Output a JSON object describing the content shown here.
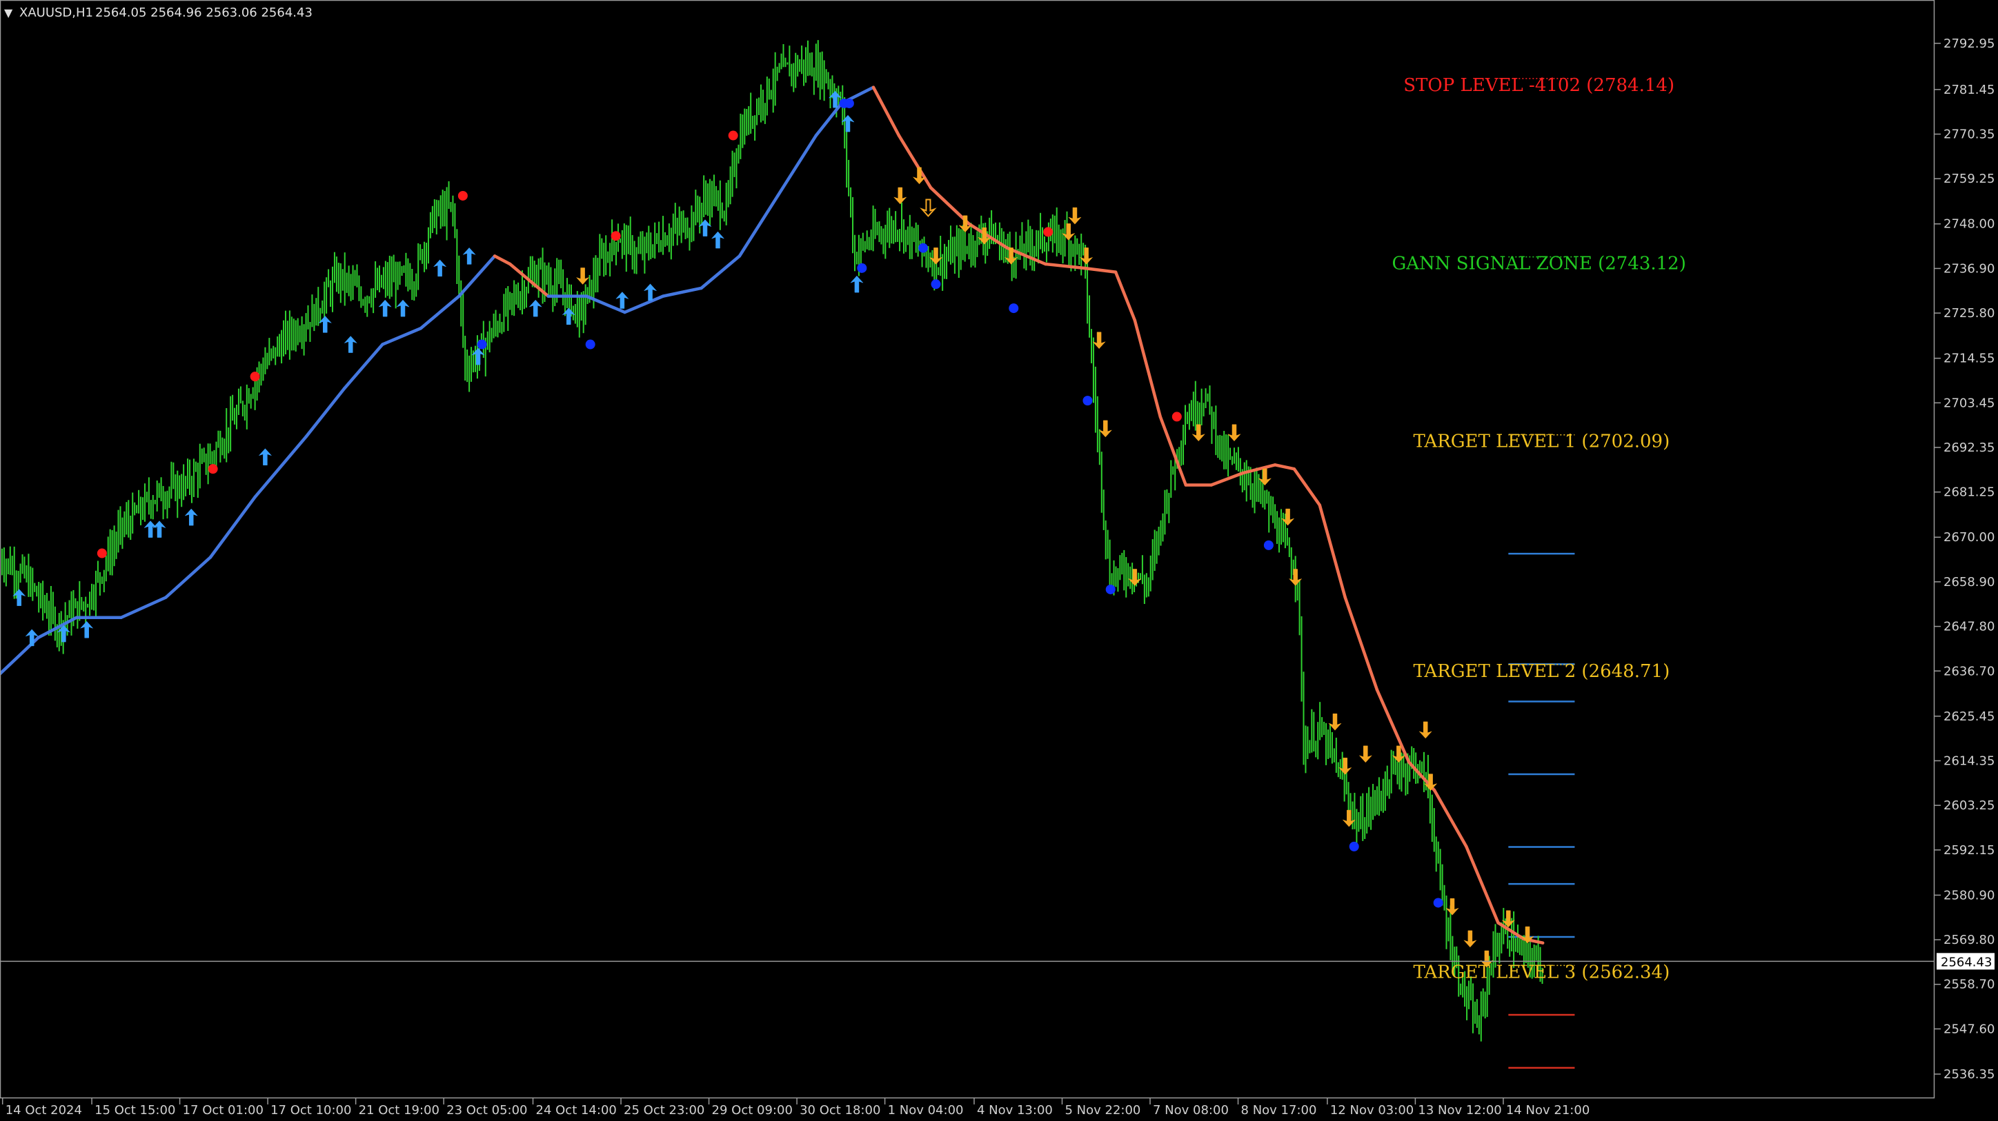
{
  "header": {
    "symbol": "XAUUSD,H1",
    "ohlc": "2564.05 2564.96 2563.06 2564.43"
  },
  "current_price": "2564.43",
  "colors": {
    "background": "#000000",
    "axis": "#9a9a9a",
    "candle": "#2fd12f",
    "ma_up": "#4477e0",
    "ma_down": "#f07050",
    "arrow_up": "#3aa0ff",
    "arrow_down": "#f5a623",
    "dot_red": "#ff1a1a",
    "dot_blue": "#1030ff",
    "stop_level": "#ff2020",
    "gann_zone": "#22cc22",
    "target": "#f0c020",
    "hline_blue": "#2f7fd8",
    "hline_red": "#d83020"
  },
  "chart_data": {
    "type": "line",
    "series": [
      {
        "name": "XAUUSD,H1",
        "x": [
          "14 Oct 2024",
          "15 Oct 15:00",
          "17 Oct 01:00",
          "17 Oct 10:00",
          "21 Oct 19:00",
          "23 Oct 05:00",
          "24 Oct 14:00",
          "25 Oct 23:00",
          "29 Oct 09:00",
          "30 Oct 18:00",
          "1 Nov 04:00",
          "4 Nov 13:00",
          "5 Nov 22:00",
          "7 Nov 08:00",
          "8 Nov 17:00",
          "12 Nov 03:00",
          "13 Nov 12:00",
          "14 Nov 21:00"
        ],
        "values": [
          2660,
          2650,
          2672,
          2690,
          2720,
          2745,
          2735,
          2740,
          2760,
          2788,
          2750,
          2742,
          2738,
          2700,
          2668,
          2625,
          2572,
          2564
        ]
      }
    ],
    "price_path": [
      [
        0,
        2665
      ],
      [
        20,
        2660
      ],
      [
        45,
        2648
      ],
      [
        70,
        2655
      ],
      [
        95,
        2672
      ],
      [
        120,
        2680
      ],
      [
        145,
        2683
      ],
      [
        165,
        2690
      ],
      [
        185,
        2700
      ],
      [
        205,
        2712
      ],
      [
        225,
        2720
      ],
      [
        245,
        2725
      ],
      [
        265,
        2735
      ],
      [
        285,
        2730
      ],
      [
        305,
        2734
      ],
      [
        325,
        2735
      ],
      [
        340,
        2750
      ],
      [
        355,
        2752
      ],
      [
        365,
        2712
      ],
      [
        380,
        2718
      ],
      [
        400,
        2728
      ],
      [
        420,
        2736
      ],
      [
        440,
        2732
      ],
      [
        455,
        2725
      ],
      [
        470,
        2738
      ],
      [
        485,
        2745
      ],
      [
        500,
        2740
      ],
      [
        520,
        2745
      ],
      [
        540,
        2748
      ],
      [
        555,
        2755
      ],
      [
        570,
        2752
      ],
      [
        580,
        2770
      ],
      [
        595,
        2778
      ],
      [
        610,
        2785
      ],
      [
        630,
        2788
      ],
      [
        645,
        2786
      ],
      [
        660,
        2778
      ],
      [
        670,
        2740
      ],
      [
        685,
        2745
      ],
      [
        705,
        2748
      ],
      [
        720,
        2742
      ],
      [
        735,
        2738
      ],
      [
        755,
        2742
      ],
      [
        775,
        2746
      ],
      [
        795,
        2740
      ],
      [
        815,
        2744
      ],
      [
        835,
        2745
      ],
      [
        850,
        2740
      ],
      [
        858,
        2706
      ],
      [
        870,
        2660
      ],
      [
        885,
        2662
      ],
      [
        900,
        2658
      ],
      [
        915,
        2680
      ],
      [
        930,
        2700
      ],
      [
        945,
        2705
      ],
      [
        960,
        2690
      ],
      [
        975,
        2686
      ],
      [
        990,
        2680
      ],
      [
        1005,
        2670
      ],
      [
        1018,
        2660
      ],
      [
        1022,
        2618
      ],
      [
        1035,
        2622
      ],
      [
        1050,
        2612
      ],
      [
        1065,
        2598
      ],
      [
        1080,
        2605
      ],
      [
        1095,
        2612
      ],
      [
        1110,
        2614
      ],
      [
        1120,
        2608
      ],
      [
        1130,
        2582
      ],
      [
        1140,
        2565
      ],
      [
        1150,
        2555
      ],
      [
        1160,
        2548
      ],
      [
        1170,
        2566
      ],
      [
        1180,
        2572
      ],
      [
        1195,
        2566
      ],
      [
        1210,
        2564
      ]
    ],
    "ma_path": [
      [
        0,
        2636
      ],
      [
        30,
        2645
      ],
      [
        60,
        2650
      ],
      [
        95,
        2650
      ],
      [
        130,
        2655
      ],
      [
        165,
        2665
      ],
      [
        200,
        2680
      ],
      [
        240,
        2695
      ],
      [
        270,
        2707
      ],
      [
        300,
        2718
      ],
      [
        330,
        2722
      ],
      [
        360,
        2730
      ],
      [
        388,
        2740
      ],
      [
        400,
        2738
      ],
      [
        430,
        2730
      ],
      [
        460,
        2730
      ],
      [
        490,
        2726
      ],
      [
        520,
        2730
      ],
      [
        550,
        2732
      ],
      [
        580,
        2740
      ],
      [
        610,
        2755
      ],
      [
        640,
        2770
      ],
      [
        660,
        2778
      ],
      [
        685,
        2782
      ],
      [
        705,
        2770
      ],
      [
        730,
        2757
      ],
      [
        760,
        2748
      ],
      [
        790,
        2742
      ],
      [
        820,
        2738
      ],
      [
        850,
        2737
      ],
      [
        875,
        2736
      ],
      [
        890,
        2724
      ],
      [
        910,
        2700
      ],
      [
        930,
        2683
      ],
      [
        950,
        2683
      ],
      [
        975,
        2686
      ],
      [
        1000,
        2688
      ],
      [
        1015,
        2687
      ],
      [
        1035,
        2678
      ],
      [
        1055,
        2655
      ],
      [
        1080,
        2632
      ],
      [
        1105,
        2614
      ],
      [
        1125,
        2607
      ],
      [
        1150,
        2593
      ],
      [
        1175,
        2574
      ],
      [
        1195,
        2570
      ],
      [
        1210,
        2569
      ]
    ],
    "markers": {
      "up_arrows": [
        [
          15,
          2655
        ],
        [
          25,
          2645
        ],
        [
          50,
          2646
        ],
        [
          68,
          2647
        ],
        [
          118,
          2672
        ],
        [
          125,
          2672
        ],
        [
          150,
          2675
        ],
        [
          208,
          2690
        ],
        [
          255,
          2723
        ],
        [
          275,
          2718
        ],
        [
          302,
          2727
        ],
        [
          316,
          2727
        ],
        [
          345,
          2737
        ],
        [
          368,
          2740
        ],
        [
          375,
          2715
        ],
        [
          420,
          2727
        ],
        [
          446,
          2725
        ],
        [
          488,
          2729
        ],
        [
          510,
          2731
        ],
        [
          553,
          2747
        ],
        [
          563,
          2744
        ],
        [
          655,
          2779
        ],
        [
          665,
          2773
        ],
        [
          672,
          2733
        ]
      ],
      "down_arrows": [
        [
          457,
          2735
        ],
        [
          706,
          2755
        ],
        [
          721,
          2760
        ],
        [
          734,
          2740
        ],
        [
          757,
          2748
        ],
        [
          772,
          2745
        ],
        [
          793,
          2740
        ],
        [
          838,
          2746
        ],
        [
          843,
          2750
        ],
        [
          852,
          2740
        ],
        [
          862,
          2719
        ],
        [
          867,
          2697
        ],
        [
          890,
          2660
        ],
        [
          940,
          2696
        ],
        [
          968,
          2696
        ],
        [
          992,
          2685
        ],
        [
          1010,
          2675
        ],
        [
          1016,
          2660
        ],
        [
          1047,
          2624
        ],
        [
          1055,
          2613
        ],
        [
          1058,
          2600
        ],
        [
          1071,
          2616
        ],
        [
          1097,
          2616
        ],
        [
          1118,
          2622
        ],
        [
          1122,
          2609
        ],
        [
          1139,
          2578
        ],
        [
          1153,
          2570
        ],
        [
          1166,
          2565
        ],
        [
          1183,
          2575
        ],
        [
          1198,
          2571
        ]
      ],
      "hollow_down_arrows": [
        [
          728,
          2752
        ]
      ],
      "red_dots": [
        [
          80,
          2666
        ],
        [
          167,
          2687
        ],
        [
          200,
          2710
        ],
        [
          363,
          2755
        ],
        [
          483,
          2745
        ],
        [
          575,
          2770
        ],
        [
          822,
          2746
        ],
        [
          923,
          2700
        ]
      ],
      "blue_dots": [
        [
          378,
          2718
        ],
        [
          463,
          2718
        ],
        [
          662,
          2778
        ],
        [
          666,
          2778
        ],
        [
          676,
          2737
        ],
        [
          724,
          2742
        ],
        [
          734,
          2733
        ],
        [
          795,
          2727
        ],
        [
          853,
          2704
        ],
        [
          871,
          2657
        ],
        [
          995,
          2668
        ],
        [
          1062,
          2593
        ],
        [
          1128,
          2579
        ]
      ]
    },
    "levels": [
      {
        "label": "STOP LEVEL -4102 (2784.14)",
        "price": 2781.1,
        "color_key": "stop_level"
      },
      {
        "label": "GANN SIGNAL ZONE (2743.12)",
        "price": 2736.7,
        "color_key": "gann_zone"
      },
      {
        "label": "TARGET LEVEL 1 (2702.09)",
        "price": 2692.4,
        "color_key": "target"
      },
      {
        "label": "TARGET LEVEL 2 (2648.71)",
        "price": 2635.2,
        "color_key": "target"
      },
      {
        "label": "TARGET LEVEL 3 (2562.34)",
        "price": 2560.3,
        "color_key": "target"
      }
    ],
    "hlines": [
      {
        "price": 2665.9,
        "color_key": "hline_blue"
      },
      {
        "price": 2638.4,
        "color_key": "hline_blue"
      },
      {
        "price": 2629.1,
        "color_key": "hline_blue"
      },
      {
        "price": 2611.0,
        "color_key": "hline_blue"
      },
      {
        "price": 2592.9,
        "color_key": "hline_blue"
      },
      {
        "price": 2583.7,
        "color_key": "hline_blue"
      },
      {
        "price": 2570.5,
        "color_key": "hline_blue"
      },
      {
        "price": 2551.1,
        "color_key": "hline_red"
      },
      {
        "price": 2537.9,
        "color_key": "hline_red"
      }
    ],
    "y_ticks": [
      "2792.95",
      "2781.45",
      "2770.35",
      "2759.25",
      "2748.00",
      "2736.90",
      "2725.80",
      "2714.55",
      "2703.45",
      "2692.35",
      "2681.25",
      "2670.00",
      "2658.90",
      "2647.80",
      "2636.70",
      "2625.45",
      "2614.35",
      "2603.25",
      "2592.15",
      "2580.90",
      "2569.80",
      "2558.70",
      "2547.60",
      "2536.35"
    ],
    "ylim": [
      2532,
      2800
    ],
    "grid": false
  }
}
